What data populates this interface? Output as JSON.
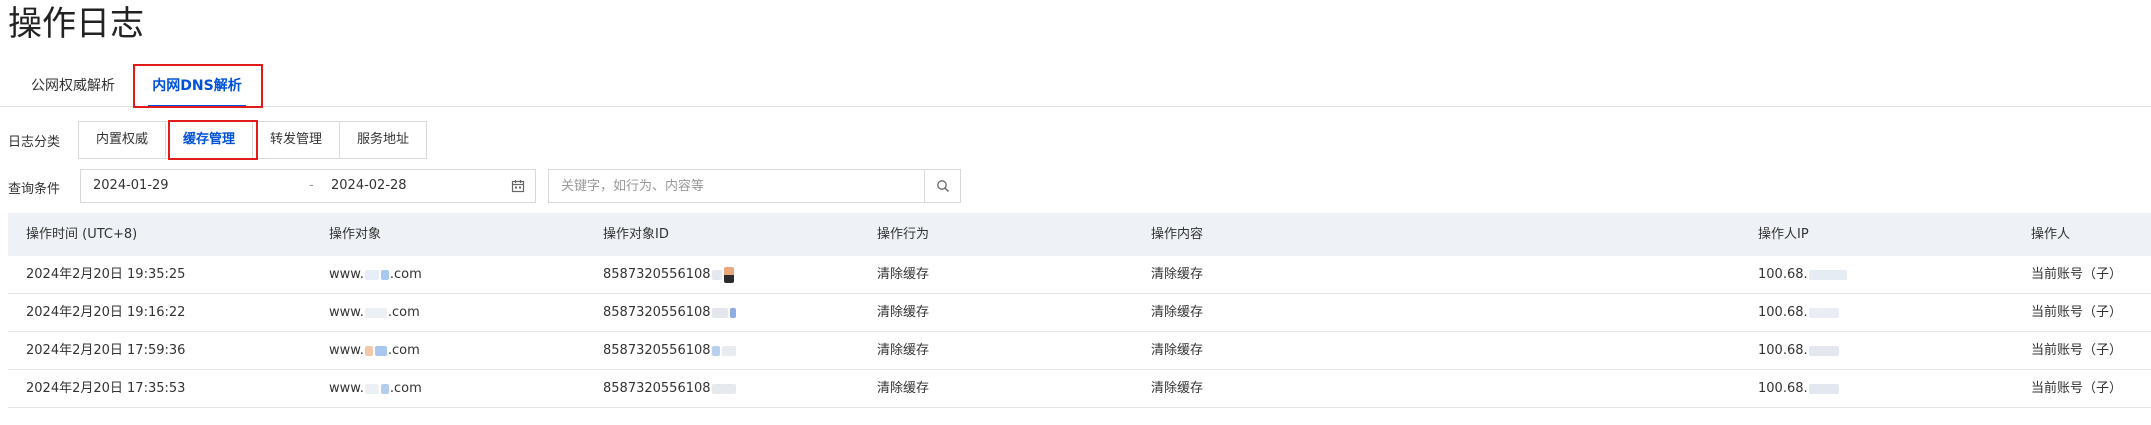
{
  "page": {
    "title": "操作日志"
  },
  "tabs": [
    {
      "label": "公网权威解析"
    },
    {
      "label": "内网DNS解析"
    }
  ],
  "log_category": {
    "label": "日志分类",
    "options": [
      "内置权威",
      "缓存管理",
      "转发管理",
      "服务地址"
    ],
    "active": "缓存管理"
  },
  "query": {
    "label": "查询条件",
    "start_date": "2024-01-29",
    "separator": "-",
    "end_date": "2024-02-28",
    "search_placeholder": "关键字，如行为、内容等"
  },
  "table": {
    "headers": [
      "操作时间 (UTC+8)",
      "操作对象",
      "操作对象ID",
      "操作行为",
      "操作内容",
      "操作人IP",
      "操作人"
    ],
    "rows": [
      {
        "time": "2024年2月20日 19:35:25",
        "object_prefix": "www.",
        "object_suffix": ".com",
        "object_id": "8587320556108",
        "action": "清除缓存",
        "content": "清除缓存",
        "ip": "100.68.",
        "operator": "当前账号（子）"
      },
      {
        "time": "2024年2月20日 19:16:22",
        "object_prefix": "www.",
        "object_suffix": ".com",
        "object_id": "8587320556108",
        "action": "清除缓存",
        "content": "清除缓存",
        "ip": "100.68.",
        "operator": "当前账号（子）"
      },
      {
        "time": "2024年2月20日 17:59:36",
        "object_prefix": "www.",
        "object_suffix": ".com",
        "object_id": "8587320556108",
        "action": "清除缓存",
        "content": "清除缓存",
        "ip": "100.68.",
        "operator": "当前账号（子）"
      },
      {
        "time": "2024年2月20日 17:35:53",
        "object_prefix": "www.",
        "object_suffix": ".com",
        "object_id": "8587320556108",
        "action": "清除缓存",
        "content": "清除缓存",
        "ip": "100.68.",
        "operator": "当前账号（子）"
      }
    ]
  },
  "colors": {
    "accent": "#0052d9",
    "highlight_border": "#e31a1a",
    "table_header_bg": "#eef1f5"
  }
}
